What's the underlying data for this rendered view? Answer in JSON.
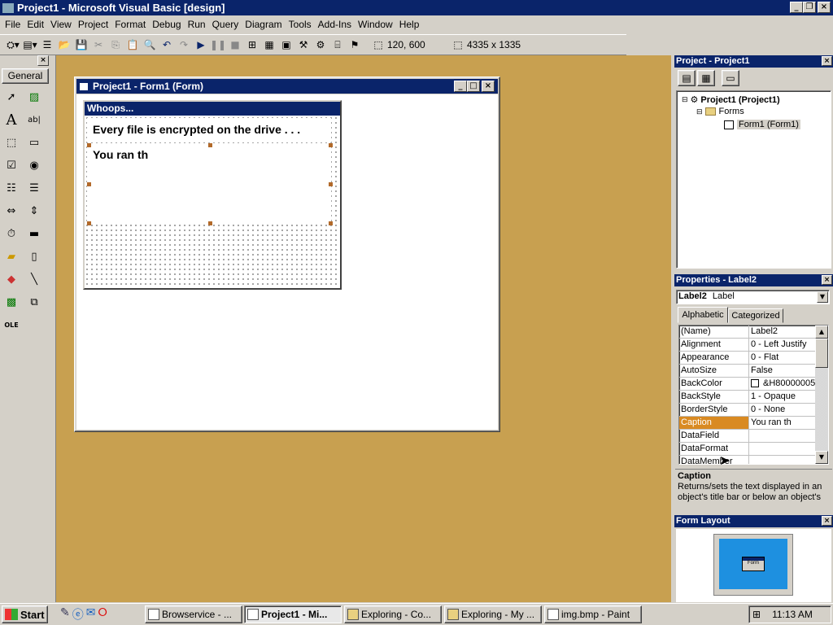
{
  "window": {
    "title": "Project1 - Microsoft Visual Basic [design]"
  },
  "menu": [
    "File",
    "Edit",
    "View",
    "Project",
    "Format",
    "Debug",
    "Run",
    "Query",
    "Diagram",
    "Tools",
    "Add-Ins",
    "Window",
    "Help"
  ],
  "toolbar": {
    "position": "120, 600",
    "size": "4335 x 1335"
  },
  "toolbox": {
    "tab_label": "General"
  },
  "form_window": {
    "title": "Project1 - Form1 (Form)"
  },
  "form": {
    "caption": "Whoops...",
    "label1": "Every file is encrypted on the drive . . .",
    "label2": "You ran th"
  },
  "project_explorer": {
    "title": "Project - Project1",
    "root": "Project1 (Project1)",
    "folder": "Forms",
    "item": "Form1 (Form1)"
  },
  "properties": {
    "title": "Properties - Label2",
    "object_name": "Label2",
    "object_type": "Label",
    "tab_alpha": "Alphabetic",
    "tab_cat": "Categorized",
    "rows": [
      {
        "name": "(Name)",
        "value": "Label2"
      },
      {
        "name": "Alignment",
        "value": "0 - Left Justify"
      },
      {
        "name": "Appearance",
        "value": "0 - Flat"
      },
      {
        "name": "AutoSize",
        "value": "False"
      },
      {
        "name": "BackColor",
        "value": "&H80000005"
      },
      {
        "name": "BackStyle",
        "value": "1 - Opaque"
      },
      {
        "name": "BorderStyle",
        "value": "0 - None"
      },
      {
        "name": "Caption",
        "value": "You ran th"
      },
      {
        "name": "DataField",
        "value": ""
      },
      {
        "name": "DataFormat",
        "value": ""
      },
      {
        "name": "DataMember",
        "value": ""
      }
    ],
    "desc_title": "Caption",
    "desc_text": "Returns/sets the text displayed in an object's title bar or below an object's"
  },
  "form_layout": {
    "title": "Form Layout",
    "mini_label": "Form"
  },
  "taskbar": {
    "start": "Start",
    "tasks": [
      "Browservice - ...",
      "Project1 - Mi...",
      "Exploring - Co...",
      "Exploring - My ...",
      "img.bmp - Paint"
    ],
    "clock": "11:13 AM"
  },
  "colors": {
    "workspace": "#c8a050",
    "title": "#0a246a",
    "selected": "#d98a22"
  }
}
